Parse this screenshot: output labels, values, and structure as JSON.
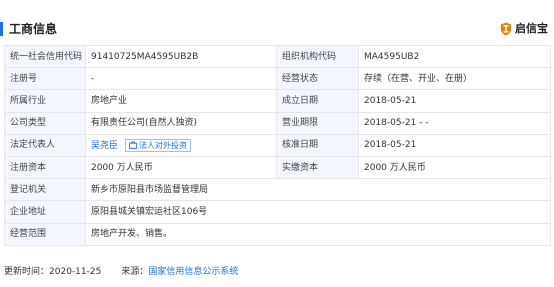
{
  "header": {
    "title": "工商信息",
    "brand_name": "启信宝",
    "brand_icon": "shield-logo-icon",
    "brand_color": "#d68a12"
  },
  "colors": {
    "accent": "#1f6fe0",
    "label_bg": "#f3f7fd",
    "border": "#e6e6e6",
    "link": "#1f6fe0"
  },
  "table": {
    "rows": [
      {
        "l1": "统一社会信用代码",
        "v1": "91410725MA4595UB2B",
        "l2": "组织机构代码",
        "v2": "MA4595UB2"
      },
      {
        "l1": "注册号",
        "v1": "-",
        "l2": "经营状态",
        "v2": "存续（在营、开业、在册）"
      },
      {
        "l1": "所属行业",
        "v1": "房地产业",
        "l2": "成立日期",
        "v2": "2018-05-21"
      },
      {
        "l1": "公司类型",
        "v1": "有限责任公司(自然人独资)",
        "l2": "营业期限",
        "v2": "2018-05-21 - -"
      },
      {
        "l1": "法定代表人",
        "v1": "吴尧臣",
        "tag": "法人对外投资",
        "l2": "核准日期",
        "v2": "2018-05-21"
      },
      {
        "l1": "注册资本",
        "v1": "2000 万人民币",
        "l2": "实缴资本",
        "v2": "2000 万人民币"
      },
      {
        "l1": "登记机关",
        "v1": "新乡市原阳县市场监督管理局"
      },
      {
        "l1": "企业地址",
        "v1": "原阳县城关镇宏运社区106号"
      },
      {
        "l1": "经营范围",
        "v1": "房地产开发、销售。"
      }
    ]
  },
  "footer": {
    "updated_label": "更新时间：",
    "updated_date": "2020-11-25",
    "source_label": "来源：",
    "source_link": "国家信用信息公示系统"
  }
}
